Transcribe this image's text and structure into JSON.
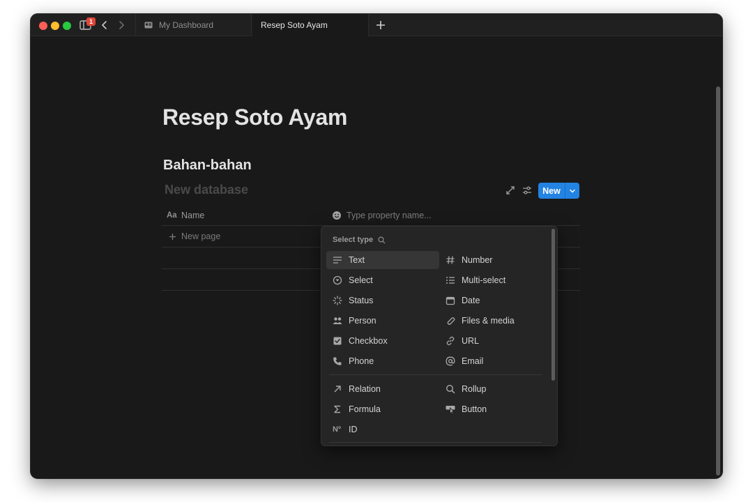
{
  "titlebar": {
    "notification_count": "1",
    "tabs": [
      {
        "label": "My Dashboard"
      },
      {
        "label": "Resep Soto Ayam"
      }
    ]
  },
  "page": {
    "title": "Resep Soto Ayam",
    "section_heading": "Bahan-bahan",
    "database_title_placeholder": "New database",
    "new_button_label": "New",
    "columns": {
      "name_icon": "Aa",
      "name_label": "Name",
      "property_placeholder": "Type property name..."
    },
    "new_page_label": "New page"
  },
  "menu": {
    "title": "Select type",
    "options_basic": [
      {
        "label": "Text",
        "icon": "text-lines-icon",
        "column": "left"
      },
      {
        "label": "Number",
        "icon": "hash-icon",
        "column": "right"
      },
      {
        "label": "Select",
        "icon": "select-circle-icon",
        "column": "left"
      },
      {
        "label": "Multi-select",
        "icon": "list-icon",
        "column": "right"
      },
      {
        "label": "Status",
        "icon": "status-spinner-icon",
        "column": "left"
      },
      {
        "label": "Date",
        "icon": "calendar-icon",
        "column": "right"
      },
      {
        "label": "Person",
        "icon": "people-icon",
        "column": "left"
      },
      {
        "label": "Files & media",
        "icon": "paperclip-icon",
        "column": "right"
      },
      {
        "label": "Checkbox",
        "icon": "checkbox-icon",
        "column": "left"
      },
      {
        "label": "URL",
        "icon": "link-icon",
        "column": "right"
      },
      {
        "label": "Phone",
        "icon": "phone-icon",
        "column": "left"
      },
      {
        "label": "Email",
        "icon": "at-icon",
        "column": "right"
      }
    ],
    "options_advanced": [
      {
        "label": "Relation",
        "icon": "arrow-up-right-icon",
        "column": "left"
      },
      {
        "label": "Rollup",
        "icon": "magnifier-icon",
        "column": "right"
      },
      {
        "label": "Formula",
        "icon": "sigma-icon",
        "column": "left"
      },
      {
        "label": "Button",
        "icon": "pointer-icon",
        "column": "right"
      },
      {
        "label": "ID",
        "icon": "numero-icon",
        "icon_text": "Nº",
        "column": "left"
      }
    ],
    "highlighted": "Text"
  },
  "colors": {
    "window_bg": "#191919",
    "menu_bg": "#252525",
    "accent_blue": "#2383e2",
    "badge_red": "#e0453a"
  }
}
